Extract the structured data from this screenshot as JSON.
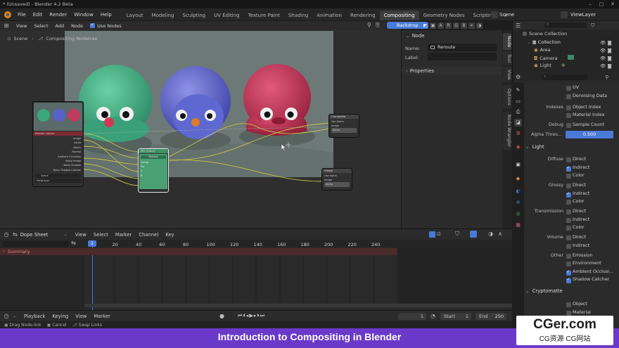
{
  "window": {
    "title": "* (Unsaved) - Blender 4.2 Beta"
  },
  "menu": {
    "items": [
      "File",
      "Edit",
      "Render",
      "Window",
      "Help"
    ],
    "workspaces": [
      "Layout",
      "Modeling",
      "Sculpting",
      "UV Editing",
      "Texture Paint",
      "Shading",
      "Animation",
      "Rendering",
      "Compositing",
      "Geometry Nodes",
      "Scripting"
    ],
    "active_workspace": "Compositing",
    "add_tab": "+",
    "scene": "Scene",
    "view_layer": "ViewLayer"
  },
  "node_editor": {
    "header": {
      "view": "View",
      "select": "Select",
      "add": "Add",
      "node": "Node",
      "use_nodes": "Use Nodes",
      "backdrop": "Backdrop"
    },
    "breadcrumb": {
      "scene": "Scene",
      "tree": "Compositing Nodetree"
    },
    "nodes": {
      "render_layers": {
        "title": "Render Layers",
        "outputs": [
          "Image",
          "Alpha",
          "Depth",
          "Normal",
          "Ambient Occlusion",
          "Noisy Image",
          "Noisy Shadow",
          "Noisy Shadow Catcher"
        ],
        "scene": "Scene",
        "layer": "ViewLayer"
      },
      "mix": {
        "title": "Mix (Color)",
        "mode": "Multiply",
        "inputs": [
          "Clamp",
          "Fac",
          "A",
          "B"
        ]
      },
      "composite": {
        "title": "Composite",
        "use_alpha": "Use Alpha",
        "inputs": [
          "Image",
          "Alpha"
        ]
      },
      "viewer": {
        "title": "Viewer",
        "use_alpha": "Use Alpha",
        "inputs": [
          "Image",
          "Alpha"
        ]
      }
    },
    "sidebar": {
      "node_section": "Node",
      "name_label": "Name:",
      "name_value": "Reroute",
      "label_label": "Label:",
      "label_value": "",
      "properties_section": "Properties",
      "tabs": [
        "Node",
        "Tool",
        "View",
        "Options",
        "Node Wrangler"
      ]
    }
  },
  "dopesheet": {
    "mode": "Dope Sheet",
    "menus": [
      "View",
      "Select",
      "Marker",
      "Channel",
      "Key"
    ],
    "current_frame": "1",
    "frames": [
      "20",
      "40",
      "60",
      "80",
      "100",
      "120",
      "140",
      "160",
      "180",
      "200",
      "220",
      "240"
    ],
    "summary": "Summary"
  },
  "timeline": {
    "menus": [
      "Playback",
      "Keying",
      "View",
      "Marker"
    ],
    "frame": "1",
    "start_label": "Start",
    "start": "1",
    "end_label": "End",
    "end": "250"
  },
  "status_bar": {
    "items": [
      "Drag Node-link",
      "Cancel",
      "Swap Links"
    ]
  },
  "outliner": {
    "root": "Scene Collection",
    "items": [
      "Collection",
      "Area",
      "Camera",
      "Light"
    ]
  },
  "properties": {
    "search_placeholder": "",
    "rows": {
      "uv": "UV",
      "denoising_data": "Denoising Data",
      "indexes_label": "Indexes",
      "object_index": "Object Index",
      "material_index": "Material Index",
      "debug_label": "Debug",
      "sample_count": "Sample Count",
      "alpha_threshold_label": "Alpha Thres...",
      "alpha_threshold_value": "0.500"
    },
    "light": {
      "title": "Light",
      "diffuse_label": "Diffuse",
      "glossy_label": "Glossy",
      "transmission_label": "Transmission",
      "volume_label": "Volume",
      "other_label": "Other",
      "direct": "Direct",
      "indirect": "Indirect",
      "color": "Color",
      "emission": "Emission",
      "environment": "Environment",
      "ambient_occlusion": "Ambient Occlusi...",
      "shadow_catcher": "Shadow Catcher"
    },
    "cryptomatte": {
      "title": "Cryptomatte",
      "object": "Object",
      "material": "Material"
    }
  },
  "banner": {
    "title": "Introduction to Compositing in Blender"
  },
  "watermark": {
    "main": "CGer.com",
    "sub": "CG资源 CG网站"
  },
  "colors": {
    "accent": "#4a7ad8",
    "banner": "#6b39c9",
    "node_green": "#3f8f66",
    "render_layers_red": "#7a2a33"
  }
}
